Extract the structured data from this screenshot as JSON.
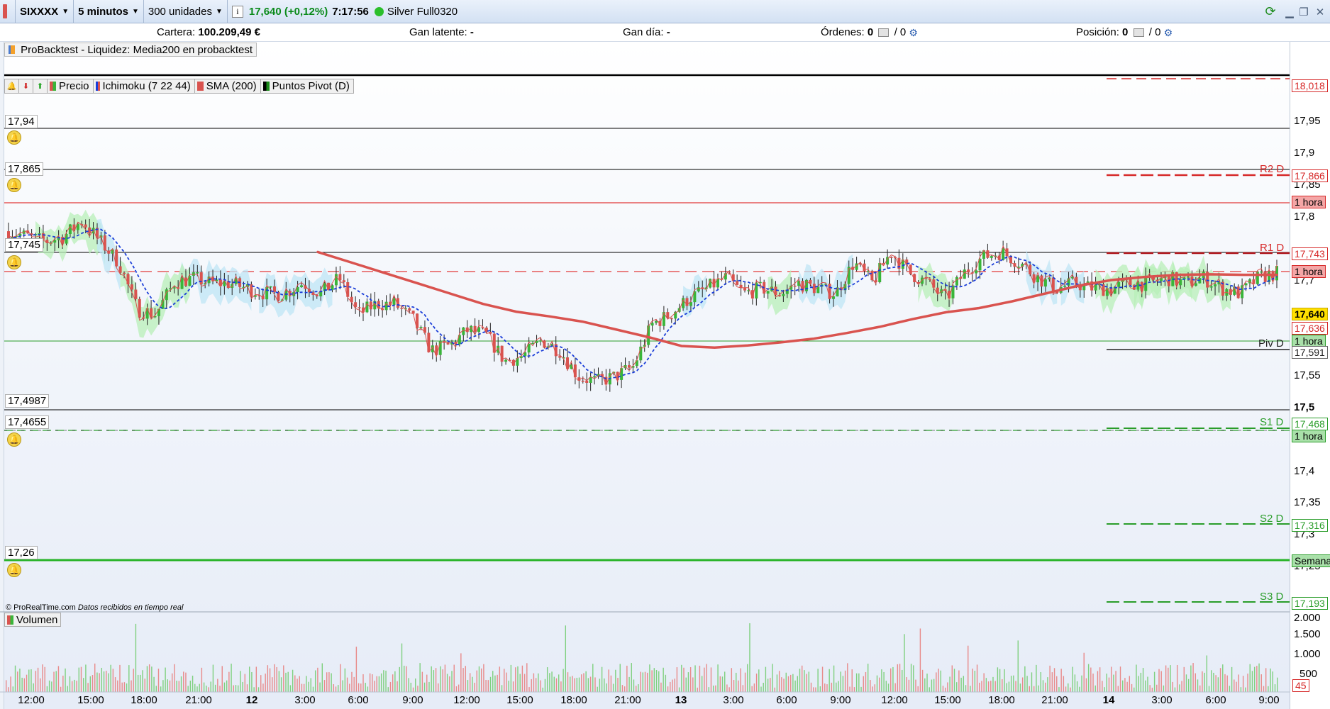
{
  "toolbar": {
    "ticker": "SIXXXX",
    "timeframe": "5 minutos",
    "units": "300 unidades",
    "price": "17,640 (+0,12%)",
    "time": "7:17:56",
    "account": "Silver Full0320",
    "colors": {
      "price_green": "#0a8a1a",
      "status_dot": "#2bbf2b"
    }
  },
  "infobar": {
    "cartera_label": "Cartera:",
    "cartera_value": "100.209,49 €",
    "gan_latente_label": "Gan latente:",
    "gan_latente_value": "-",
    "gan_dia_label": "Gan día:",
    "gan_dia_value": "-",
    "ordenes_label": "Órdenes:",
    "ordenes_value": "0",
    "ordenes_sep": "/ 0",
    "posicion_label": "Posición:",
    "posicion_value": "0",
    "posicion_sep": "/ 0"
  },
  "backtest_label": "ProBacktest - Liquidez: Media200 en probacktest",
  "legend": {
    "precio": "Precio",
    "ichimoku": "Ichimoku (7 22 44)",
    "sma": "SMA (200)",
    "pivot": "Puntos Pivot (D)",
    "volumen": "Volumen"
  },
  "alert_tags": [
    "17,94",
    "17,865",
    "17,745",
    "17,4987",
    "17,4655",
    "17,26"
  ],
  "copyright": "© ProRealTime.com",
  "copyright_note": "Datos recibidos en tiempo real",
  "chart_data": {
    "type": "candlestick",
    "timeframe": "5 minutos",
    "y_ticks": [
      "17,95",
      "17,9",
      "17,85",
      "17,8",
      "17,7",
      "17,55",
      "17,5",
      "17,4",
      "17,35",
      "17,3",
      "17,25"
    ],
    "ylim": [
      17.17,
      18.03
    ],
    "x_ticks": [
      "12:00",
      "15:00",
      "18:00",
      "21:00",
      "12",
      "3:00",
      "6:00",
      "9:00",
      "12:00",
      "15:00",
      "18:00",
      "21:00",
      "13",
      "3:00",
      "6:00",
      "9:00",
      "12:00",
      "15:00",
      "18:00",
      "21:00",
      "14",
      "3:00",
      "6:00",
      "9:00"
    ],
    "bold_x_ticks": [
      "12",
      "13",
      "14"
    ],
    "last_price": "17,640",
    "right_labels": [
      {
        "text": "18,018",
        "color": "#d62828"
      },
      {
        "text": "17,866",
        "color": "#d62828"
      },
      {
        "text": "1 hora",
        "color": "#d62828"
      },
      {
        "text": "17,743",
        "color": "#d62828"
      },
      {
        "text": "1 hora",
        "color": "#d62828"
      },
      {
        "text": "17,640",
        "color": "#e8c000"
      },
      {
        "text": "17,636",
        "color": "#d62828"
      },
      {
        "text": "1 hora",
        "color": "#2a9d2a"
      },
      {
        "text": "17,591",
        "color": "#333333"
      },
      {
        "text": "17,468",
        "color": "#2a9d2a"
      },
      {
        "text": "1 hora",
        "color": "#2a9d2a"
      },
      {
        "text": "17,316",
        "color": "#2a9d2a"
      },
      {
        "text": "Semanal",
        "color": "#2a9d2a"
      },
      {
        "text": "17,193",
        "color": "#2a9d2a"
      }
    ],
    "pivot_levels": [
      {
        "name": "R2 D",
        "value": 17.866,
        "color": "#d62828"
      },
      {
        "name": "R1 D",
        "value": 17.743,
        "color": "#d62828"
      },
      {
        "name": "Piv D",
        "value": 17.591,
        "color": "#333333"
      },
      {
        "name": "S1 D",
        "value": 17.468,
        "color": "#2a9d2a"
      },
      {
        "name": "S2 D",
        "value": 17.316,
        "color": "#2a9d2a"
      },
      {
        "name": "S3 D",
        "value": 17.193,
        "color": "#2a9d2a"
      }
    ],
    "sma200": {
      "name": "SMA (200)",
      "color": "#d9534f",
      "values": [
        17.68,
        17.66,
        17.64,
        17.62,
        17.6,
        17.58,
        17.565,
        17.556,
        17.546,
        17.531,
        17.516,
        17.499,
        17.496,
        17.5,
        17.506,
        17.513,
        17.524,
        17.536,
        17.551,
        17.564,
        17.572,
        17.585,
        17.6,
        17.615,
        17.626,
        17.632,
        17.636,
        17.637,
        17.636,
        17.636
      ]
    },
    "price_series": {
      "name": "Precio",
      "values": [
        17.72,
        17.71,
        17.7,
        17.71,
        17.74,
        17.7,
        17.66,
        17.57,
        17.56,
        17.62,
        17.63,
        17.62,
        17.62,
        17.61,
        17.6,
        17.6,
        17.62,
        17.6,
        17.63,
        17.56,
        17.58,
        17.58,
        17.55,
        17.49,
        17.5,
        17.53,
        17.52,
        17.47,
        17.48,
        17.51,
        17.49,
        17.44,
        17.43,
        17.44,
        17.46,
        17.54,
        17.56,
        17.59,
        17.61,
        17.63,
        17.6,
        17.61,
        17.6,
        17.62,
        17.61,
        17.6,
        17.66,
        17.62,
        17.68,
        17.64,
        17.62,
        17.59,
        17.64,
        17.67,
        17.68,
        17.66,
        17.63,
        17.61,
        17.62,
        17.61,
        17.61,
        17.62,
        17.62,
        17.63,
        17.62,
        17.63,
        17.61,
        17.6,
        17.63,
        17.64
      ]
    },
    "volume": {
      "name": "Volumen",
      "y_ticks": [
        "2.000",
        "1.500",
        "1.000",
        "500"
      ],
      "last_value": "45"
    },
    "grid": false,
    "legend_position": "top-left"
  }
}
